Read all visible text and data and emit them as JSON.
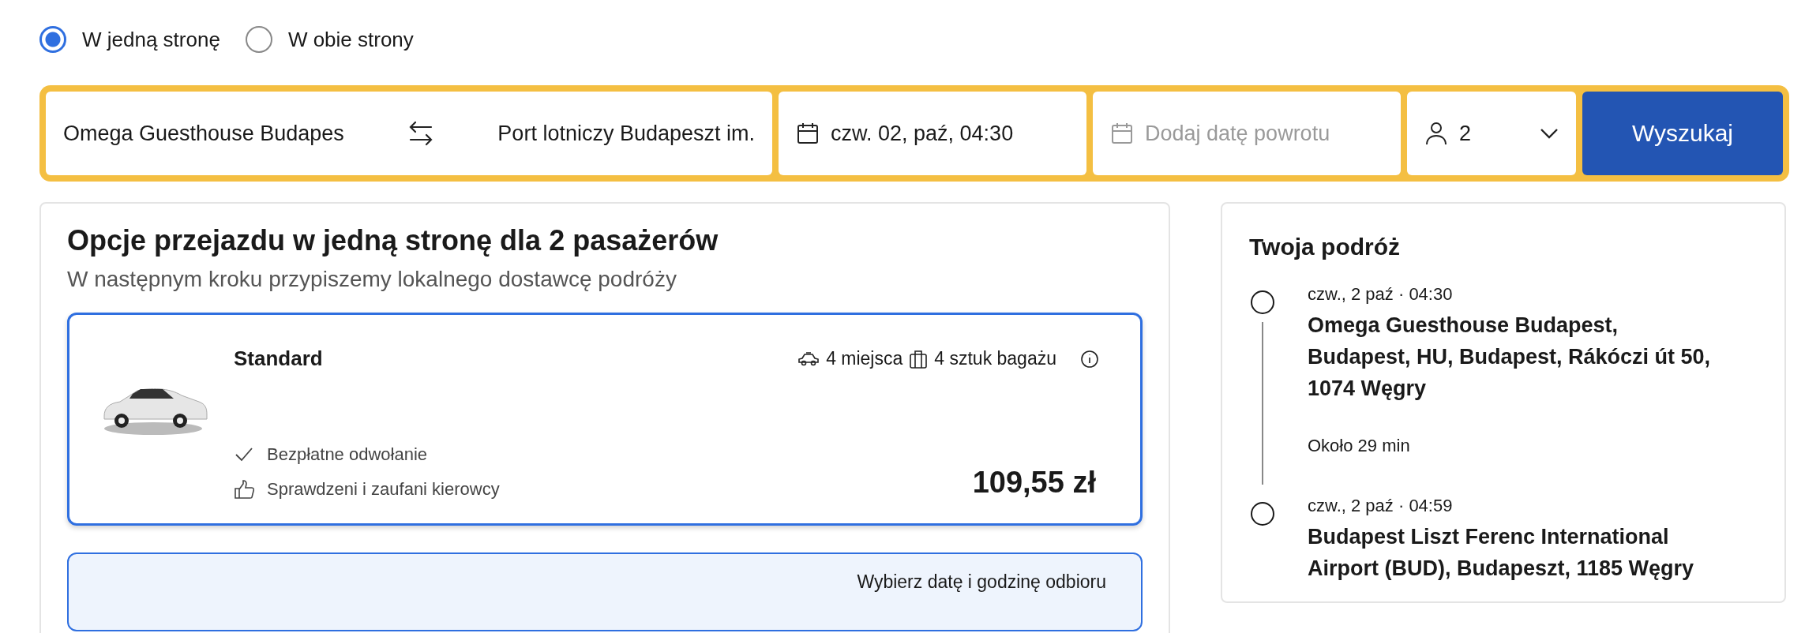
{
  "trip_type": [
    {
      "label": "W jedną stronę",
      "selected": true
    },
    {
      "label": "W obie strony",
      "selected": false
    }
  ],
  "search": {
    "origin": "Omega Guesthouse Budapes",
    "destination": "Port lotniczy Budapeszt im.",
    "date": "czw. 02, paź, 04:30",
    "return_placeholder": "Dodaj datę powrotu",
    "passengers": "2",
    "button": "Wyszukaj"
  },
  "results": {
    "title": "Opcje przejazdu w jedną stronę dla 2 pasażerów",
    "subtitle": "W następnym kroku przypiszemy lokalnego dostawcę podróży",
    "options": [
      {
        "name": "Standard",
        "seats": "4 miejsca",
        "luggage": "4 sztuk bagażu",
        "selected": true,
        "price": "109,55 zł",
        "features": [
          {
            "kind": "check",
            "text": "Bezpłatne odwołanie"
          },
          {
            "kind": "thumb",
            "text": "Sprawdzeni i zaufani kierowcy"
          }
        ]
      }
    ],
    "pickup_prompt": "Wybierz datę i godzinę odbioru"
  },
  "trip": {
    "title": "Twoja podróż",
    "stops": [
      {
        "time": "czw., 2 paź · 04:30",
        "place": "Omega Guesthouse Budapest, Budapest, HU, Budapest, Rákóczi út 50, 1074 Węgry"
      },
      {
        "time": "czw., 2 paź · 04:59",
        "place": "Budapest Liszt Ferenc International Airport (BUD), Budapeszt, 1185 Węgry"
      }
    ],
    "duration": "Około 29 min"
  }
}
